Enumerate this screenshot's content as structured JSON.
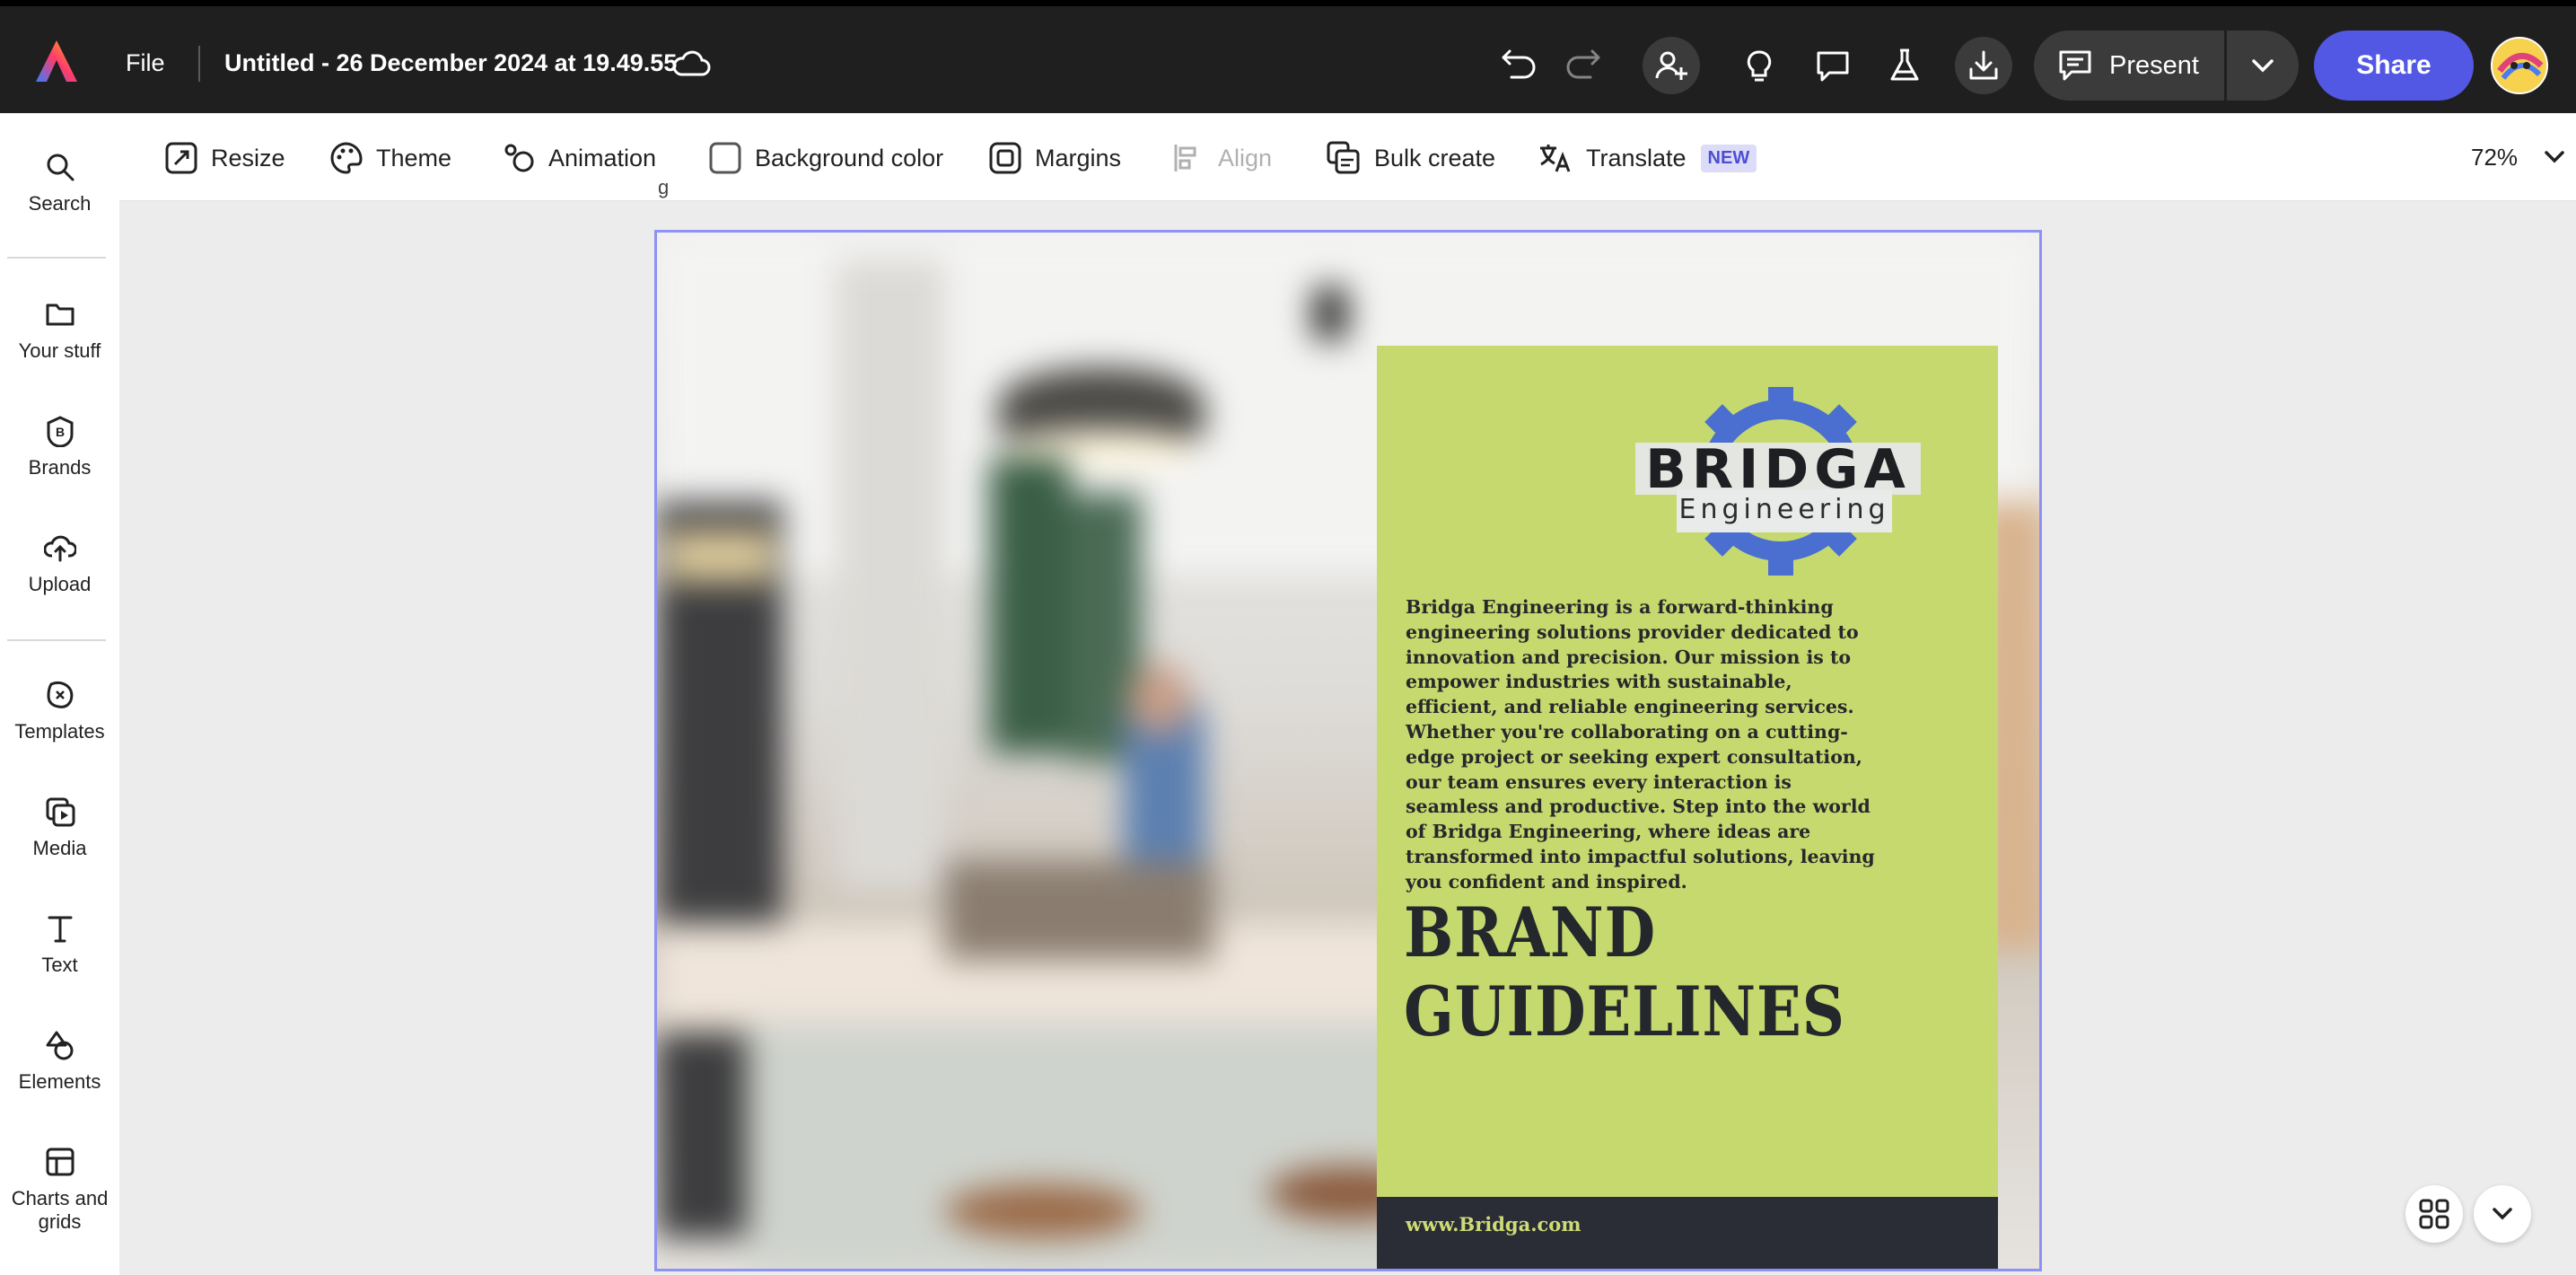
{
  "header": {
    "file_label": "File",
    "doc_title": "Untitled - 26 December 2024 at 19.49.55",
    "present_label": "Present",
    "share_label": "Share",
    "icons": [
      "adobe-express-logo",
      "cloud-icon",
      "undo-icon",
      "redo-icon",
      "add-person-icon",
      "lightbulb-icon",
      "comment-icon",
      "flask-icon",
      "download-icon",
      "present-icon",
      "chevron-down-icon",
      "avatar"
    ]
  },
  "sidebar": {
    "items": [
      {
        "label": "Search",
        "icon": "search-icon"
      },
      {
        "label": "Your stuff",
        "icon": "folder-icon"
      },
      {
        "label": "Brands",
        "icon": "brand-icon"
      },
      {
        "label": "Upload",
        "icon": "upload-icon"
      },
      {
        "label": "Templates",
        "icon": "templates-icon"
      },
      {
        "label": "Media",
        "icon": "media-icon"
      },
      {
        "label": "Text",
        "icon": "text-icon"
      },
      {
        "label": "Elements",
        "icon": "elements-icon"
      },
      {
        "label": "Charts and grids",
        "icon": "charts-grids-icon"
      }
    ]
  },
  "toolbar": {
    "resize": "Resize",
    "theme": "Theme",
    "animation": "Animation",
    "background_color": "Background color",
    "margins": "Margins",
    "align": "Align",
    "bulk_create": "Bulk create",
    "translate": "Translate",
    "new_badge": "NEW",
    "zoom": "72%"
  },
  "canvas": {
    "overlay_label": "g",
    "design": {
      "logo_name": "BRIDGA",
      "logo_sub": "Engineering",
      "about_text": "Bridga Engineering is a forward-thinking engineering solutions provider dedicated to innovation and precision. Our mission is to empower industries with sustainable, efficient, and reliable engineering services. Whether you're collaborating on a cutting-edge project or seeking expert consultation, our team ensures every interaction is seamless and productive. Step into the world of Bridga Engineering, where ideas are transformed into impactful solutions, leaving you confident and inspired.",
      "headline_line1": "BRAND",
      "headline_line2": "GUIDELINES",
      "url": "www.Bridga.com"
    }
  },
  "colors": {
    "topbar": "#1f1f1f",
    "share": "#5258e4",
    "selection": "#8e92f2",
    "panel": "#c6d96e",
    "footer": "#2b2d36",
    "gear": "#4a6fd1"
  }
}
